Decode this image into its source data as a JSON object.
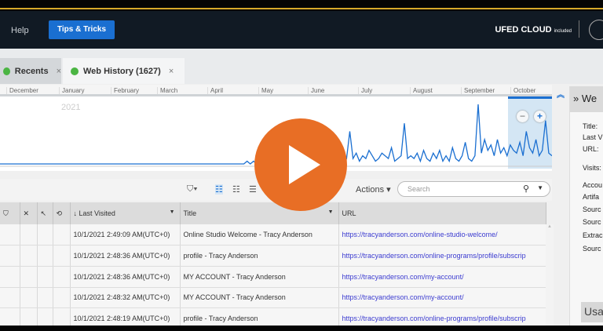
{
  "header": {
    "help": "Help",
    "tips": "Tips & Tricks",
    "ufed": "UFED CLOUD",
    "ufed_sub": "included"
  },
  "tabs": [
    {
      "label": "Recents",
      "close": "×"
    },
    {
      "label": "Web History (1627)",
      "close": "×",
      "status_color": "#4bb543"
    }
  ],
  "timeline": {
    "months": [
      "December",
      "January",
      "February",
      "March",
      "April",
      "May",
      "June",
      "July",
      "August",
      "September",
      "October"
    ],
    "year": "2021",
    "zoom_out": "−",
    "zoom_in": "+",
    "activity": [
      0,
      0,
      0,
      0,
      0,
      0,
      0,
      0,
      0,
      0,
      0,
      0,
      0,
      0,
      0,
      0,
      0,
      0,
      0,
      0,
      0,
      0,
      0,
      0,
      0,
      0,
      0,
      0,
      0,
      0,
      0,
      0,
      0,
      0,
      0,
      0,
      0,
      0,
      0,
      0,
      0,
      0,
      0,
      0,
      0,
      0,
      0,
      0,
      0,
      0,
      0,
      0,
      0,
      0,
      0,
      0,
      0,
      0,
      0,
      0,
      0,
      0,
      0,
      0,
      0,
      0,
      0,
      0,
      0,
      0,
      0,
      0,
      0,
      0,
      0,
      0,
      0,
      1,
      0,
      1,
      0,
      0,
      0,
      0,
      0,
      0,
      0,
      0,
      0,
      0,
      0,
      0,
      0,
      0,
      0,
      0,
      1,
      0,
      0,
      0,
      4,
      1,
      6,
      2,
      1,
      5,
      1,
      3,
      2,
      12,
      2,
      4,
      1,
      3,
      2,
      5,
      3,
      1,
      2,
      4,
      3,
      2,
      6,
      1,
      2,
      3,
      15,
      2,
      3,
      2,
      4,
      1,
      5,
      2,
      1,
      4,
      2,
      5,
      1,
      3,
      1,
      6,
      2,
      1,
      3,
      8,
      2,
      1,
      3,
      22,
      4,
      9,
      5,
      7,
      3,
      9,
      4,
      6,
      3,
      7,
      5,
      4,
      8,
      3,
      12,
      6,
      4,
      9,
      3,
      5,
      16,
      4,
      3
    ],
    "accent": "#1a6fd1"
  },
  "toolbar": {
    "actions": "Actions ▾",
    "search_placeholder": "Search"
  },
  "table": {
    "columns": [
      "Last Visited",
      "Title",
      "URL"
    ],
    "rows": [
      {
        "visited": "10/1/2021 2:49:09 AM(UTC+0)",
        "title": "Online Studio Welcome - Tracy Anderson",
        "url": "https://tracyanderson.com/online-studio-welcome/"
      },
      {
        "visited": "10/1/2021 2:48:36 AM(UTC+0)",
        "title": "profile - Tracy Anderson",
        "url": "https://tracyanderson.com/online-programs/profile/subscrip"
      },
      {
        "visited": "10/1/2021 2:48:36 AM(UTC+0)",
        "title": "MY ACCOUNT - Tracy Anderson",
        "url": "https://tracyanderson.com/my-account/"
      },
      {
        "visited": "10/1/2021 2:48:32 AM(UTC+0)",
        "title": "MY ACCOUNT - Tracy Anderson",
        "url": "https://tracyanderson.com/my-account/"
      },
      {
        "visited": "10/1/2021 2:48:19 AM(UTC+0)",
        "title": "profile - Tracy Anderson",
        "url": "https://tracyanderson.com/online-programs/profile/subscrip"
      }
    ]
  },
  "details": {
    "header": "» We",
    "labels": [
      "Title:",
      "Last V",
      "URL:",
      "Visits:",
      "Accou",
      "Artifa",
      "Sourc",
      "Sourc",
      "Extrac",
      "Sourc"
    ],
    "usage": "Usa"
  },
  "play_color": "#e86e25"
}
